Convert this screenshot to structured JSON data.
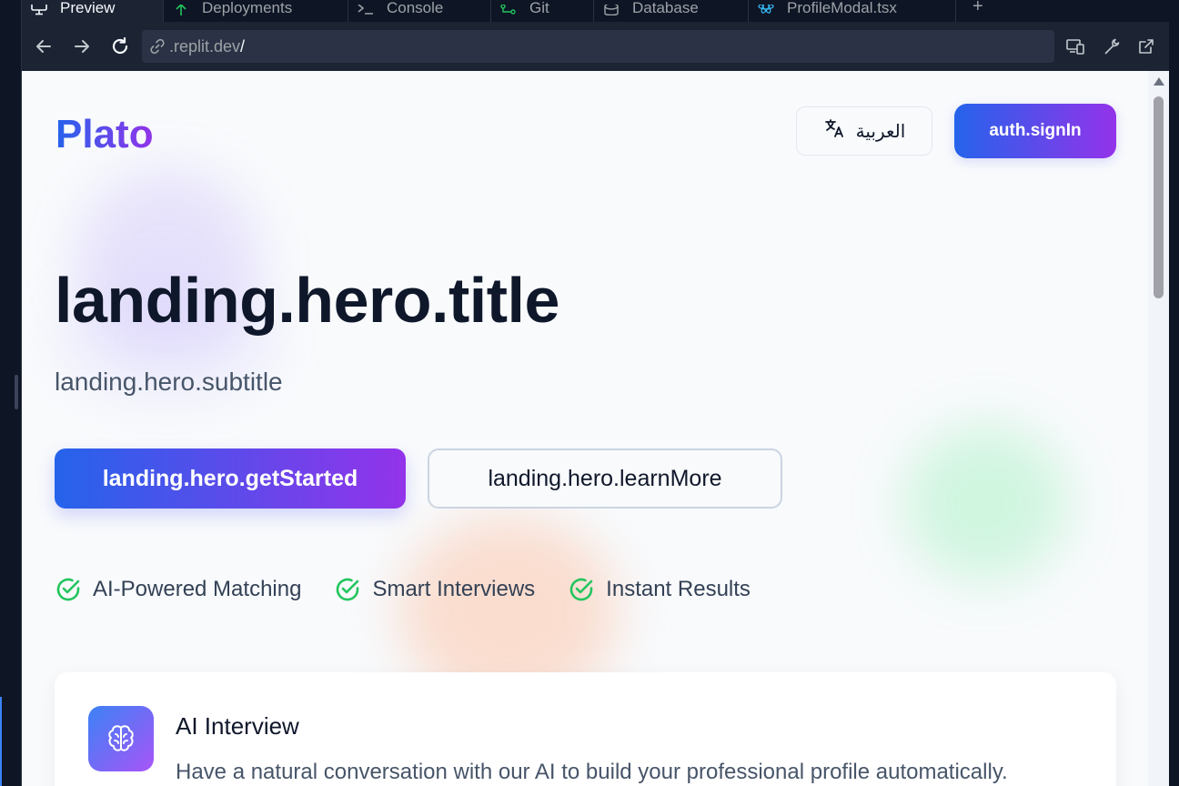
{
  "ide": {
    "tabs": [
      {
        "label": "Preview",
        "icon": "monitor-icon",
        "active": true
      },
      {
        "label": "Deployments",
        "icon": "deploy-icon",
        "active": false
      },
      {
        "label": "Console",
        "icon": "terminal-icon",
        "active": false
      },
      {
        "label": "Git",
        "icon": "git-icon",
        "active": false
      },
      {
        "label": "Database",
        "icon": "database-icon",
        "active": false
      },
      {
        "label": "ProfileModal.tsx",
        "icon": "react-icon",
        "active": false
      }
    ],
    "add_tab_label": "+",
    "url_host": ".replit.dev",
    "url_path": "/"
  },
  "app": {
    "logo": "Plato",
    "language_button": "العربية",
    "signin_button": "auth.signIn",
    "hero": {
      "title": "landing.hero.title",
      "subtitle": "landing.hero.subtitle",
      "get_started": "landing.hero.getStarted",
      "learn_more": "landing.hero.learnMore"
    },
    "features": [
      "AI-Powered Matching",
      "Smart Interviews",
      "Instant Results"
    ],
    "card": {
      "title": "AI Interview",
      "description": "Have a natural conversation with our AI to build your professional profile automatically."
    }
  },
  "colors": {
    "gradient_start": "#2563eb",
    "gradient_end": "#9333ea",
    "check_green": "#22c55e",
    "ide_bg": "#1c2333"
  }
}
